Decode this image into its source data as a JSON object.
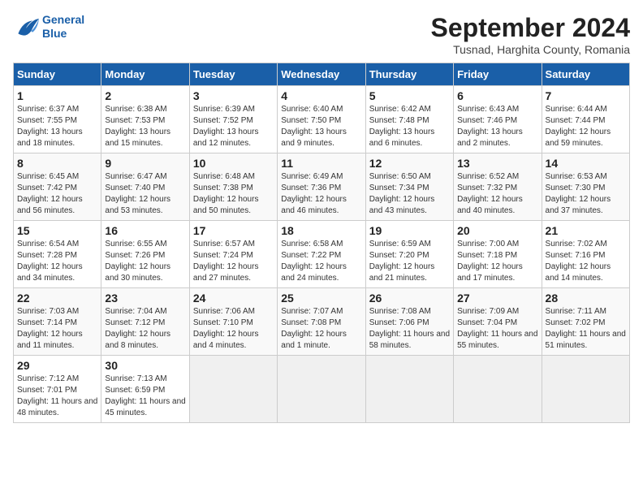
{
  "header": {
    "logo_line1": "General",
    "logo_line2": "Blue",
    "month": "September 2024",
    "location": "Tusnad, Harghita County, Romania"
  },
  "weekdays": [
    "Sunday",
    "Monday",
    "Tuesday",
    "Wednesday",
    "Thursday",
    "Friday",
    "Saturday"
  ],
  "weeks": [
    [
      {
        "day": "1",
        "sunrise": "6:37 AM",
        "sunset": "7:55 PM",
        "daylight": "13 hours and 18 minutes."
      },
      {
        "day": "2",
        "sunrise": "6:38 AM",
        "sunset": "7:53 PM",
        "daylight": "13 hours and 15 minutes."
      },
      {
        "day": "3",
        "sunrise": "6:39 AM",
        "sunset": "7:52 PM",
        "daylight": "13 hours and 12 minutes."
      },
      {
        "day": "4",
        "sunrise": "6:40 AM",
        "sunset": "7:50 PM",
        "daylight": "13 hours and 9 minutes."
      },
      {
        "day": "5",
        "sunrise": "6:42 AM",
        "sunset": "7:48 PM",
        "daylight": "13 hours and 6 minutes."
      },
      {
        "day": "6",
        "sunrise": "6:43 AM",
        "sunset": "7:46 PM",
        "daylight": "13 hours and 2 minutes."
      },
      {
        "day": "7",
        "sunrise": "6:44 AM",
        "sunset": "7:44 PM",
        "daylight": "12 hours and 59 minutes."
      }
    ],
    [
      {
        "day": "8",
        "sunrise": "6:45 AM",
        "sunset": "7:42 PM",
        "daylight": "12 hours and 56 minutes."
      },
      {
        "day": "9",
        "sunrise": "6:47 AM",
        "sunset": "7:40 PM",
        "daylight": "12 hours and 53 minutes."
      },
      {
        "day": "10",
        "sunrise": "6:48 AM",
        "sunset": "7:38 PM",
        "daylight": "12 hours and 50 minutes."
      },
      {
        "day": "11",
        "sunrise": "6:49 AM",
        "sunset": "7:36 PM",
        "daylight": "12 hours and 46 minutes."
      },
      {
        "day": "12",
        "sunrise": "6:50 AM",
        "sunset": "7:34 PM",
        "daylight": "12 hours and 43 minutes."
      },
      {
        "day": "13",
        "sunrise": "6:52 AM",
        "sunset": "7:32 PM",
        "daylight": "12 hours and 40 minutes."
      },
      {
        "day": "14",
        "sunrise": "6:53 AM",
        "sunset": "7:30 PM",
        "daylight": "12 hours and 37 minutes."
      }
    ],
    [
      {
        "day": "15",
        "sunrise": "6:54 AM",
        "sunset": "7:28 PM",
        "daylight": "12 hours and 34 minutes."
      },
      {
        "day": "16",
        "sunrise": "6:55 AM",
        "sunset": "7:26 PM",
        "daylight": "12 hours and 30 minutes."
      },
      {
        "day": "17",
        "sunrise": "6:57 AM",
        "sunset": "7:24 PM",
        "daylight": "12 hours and 27 minutes."
      },
      {
        "day": "18",
        "sunrise": "6:58 AM",
        "sunset": "7:22 PM",
        "daylight": "12 hours and 24 minutes."
      },
      {
        "day": "19",
        "sunrise": "6:59 AM",
        "sunset": "7:20 PM",
        "daylight": "12 hours and 21 minutes."
      },
      {
        "day": "20",
        "sunrise": "7:00 AM",
        "sunset": "7:18 PM",
        "daylight": "12 hours and 17 minutes."
      },
      {
        "day": "21",
        "sunrise": "7:02 AM",
        "sunset": "7:16 PM",
        "daylight": "12 hours and 14 minutes."
      }
    ],
    [
      {
        "day": "22",
        "sunrise": "7:03 AM",
        "sunset": "7:14 PM",
        "daylight": "12 hours and 11 minutes."
      },
      {
        "day": "23",
        "sunrise": "7:04 AM",
        "sunset": "7:12 PM",
        "daylight": "12 hours and 8 minutes."
      },
      {
        "day": "24",
        "sunrise": "7:06 AM",
        "sunset": "7:10 PM",
        "daylight": "12 hours and 4 minutes."
      },
      {
        "day": "25",
        "sunrise": "7:07 AM",
        "sunset": "7:08 PM",
        "daylight": "12 hours and 1 minute."
      },
      {
        "day": "26",
        "sunrise": "7:08 AM",
        "sunset": "7:06 PM",
        "daylight": "11 hours and 58 minutes."
      },
      {
        "day": "27",
        "sunrise": "7:09 AM",
        "sunset": "7:04 PM",
        "daylight": "11 hours and 55 minutes."
      },
      {
        "day": "28",
        "sunrise": "7:11 AM",
        "sunset": "7:02 PM",
        "daylight": "11 hours and 51 minutes."
      }
    ],
    [
      {
        "day": "29",
        "sunrise": "7:12 AM",
        "sunset": "7:01 PM",
        "daylight": "11 hours and 48 minutes."
      },
      {
        "day": "30",
        "sunrise": "7:13 AM",
        "sunset": "6:59 PM",
        "daylight": "11 hours and 45 minutes."
      },
      null,
      null,
      null,
      null,
      null
    ]
  ]
}
